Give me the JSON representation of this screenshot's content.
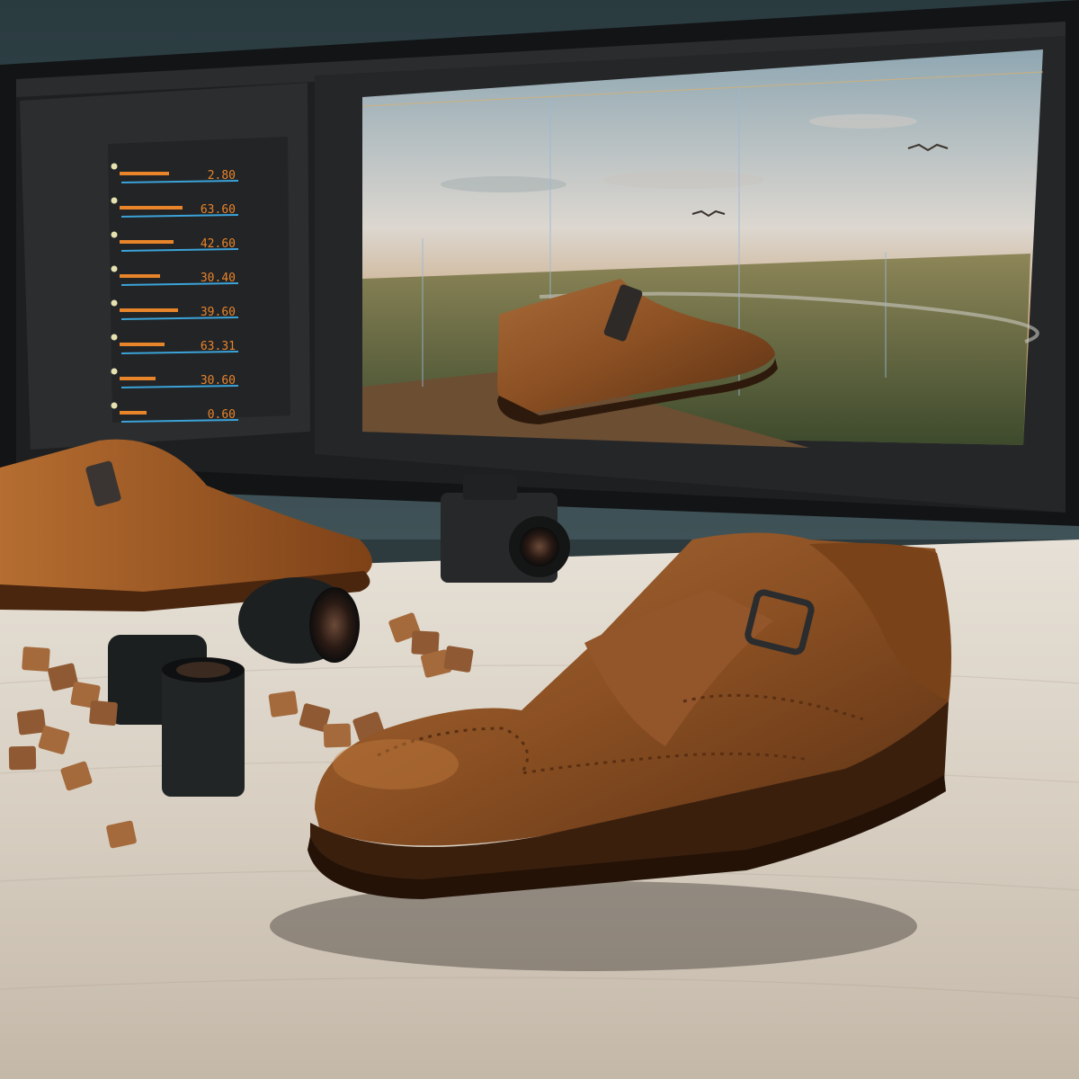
{
  "scene": {
    "description_colors": {
      "wall": "#33464b",
      "desk": "#d9d2c8",
      "leather": "#8a4f22",
      "leather_light": "#b06a32",
      "monitor_bezel": "#141618",
      "panel_bg": "#2b2c2e",
      "accent_orange": "#e8842a",
      "accent_blue": "#3ba3d8"
    }
  },
  "monitor": {
    "status_label": "",
    "panel_values": [
      {
        "value": "2.80",
        "level": 0.55
      },
      {
        "value": "63.60",
        "level": 0.7
      },
      {
        "value": "42.60",
        "level": 0.6
      },
      {
        "value": "30.40",
        "level": 0.45
      },
      {
        "value": "39.60",
        "level": 0.65
      },
      {
        "value": "63.31",
        "level": 0.5
      },
      {
        "value": "30.60",
        "level": 0.4
      },
      {
        "value": "0.60",
        "level": 0.3
      }
    ]
  },
  "icons": {
    "camera": "camera-icon",
    "lens": "lens-icon"
  }
}
